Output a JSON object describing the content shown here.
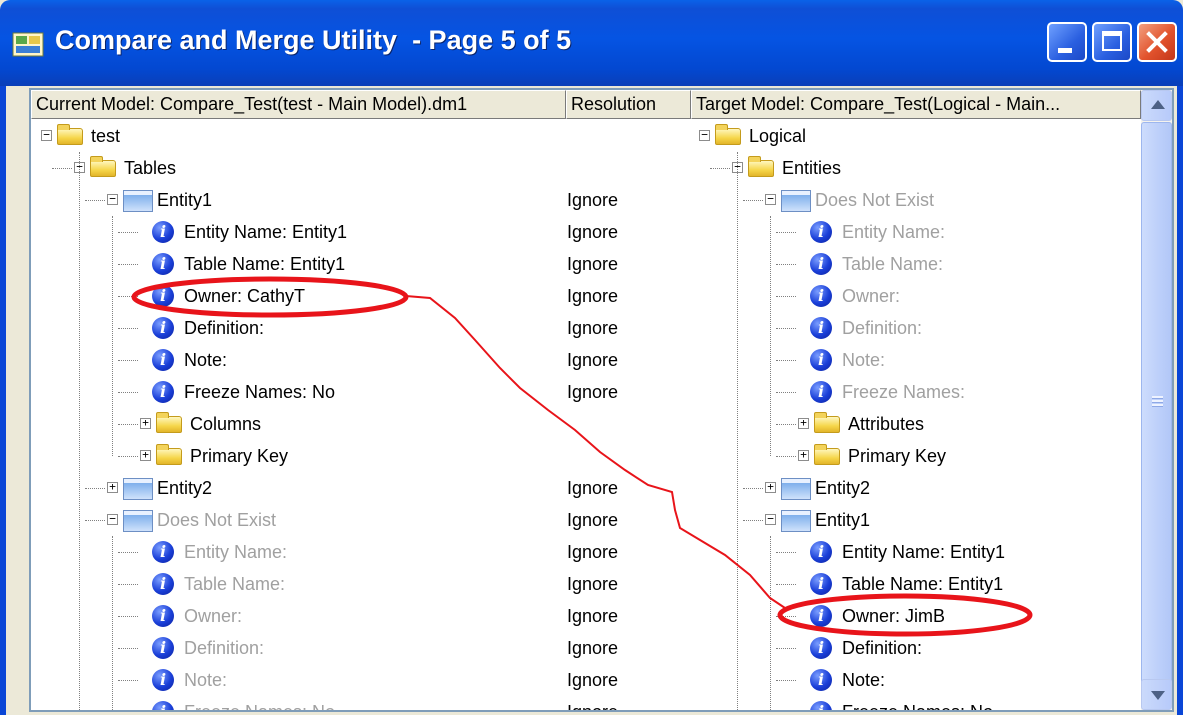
{
  "window": {
    "title": "Compare and Merge Utility  - Page 5 of 5",
    "buttons": {
      "minimize": "minimize",
      "maximize": "maximize",
      "close": "close"
    }
  },
  "columns": {
    "current": "Current Model: Compare_Test(test - Main Model).dm1",
    "resolution": "Resolution",
    "target": "Target Model: Compare_Test(Logical - Main..."
  },
  "left_tree": [
    {
      "text": "test",
      "icon": "folder",
      "expander": "minus",
      "dim": false,
      "res": ""
    },
    {
      "text": "Tables",
      "icon": "folder",
      "expander": "minus",
      "dim": false,
      "res": ""
    },
    {
      "text": "Entity1",
      "icon": "table",
      "expander": "minus",
      "dim": false,
      "res": "Ignore"
    },
    {
      "text": "Entity Name: Entity1",
      "icon": "info",
      "expander": "",
      "dim": false,
      "res": "Ignore"
    },
    {
      "text": "Table Name: Entity1",
      "icon": "info",
      "expander": "",
      "dim": false,
      "res": "Ignore"
    },
    {
      "text": "Owner: CathyT",
      "icon": "info",
      "expander": "",
      "dim": false,
      "res": "Ignore"
    },
    {
      "text": "Definition:",
      "icon": "info",
      "expander": "",
      "dim": false,
      "res": "Ignore"
    },
    {
      "text": "Note:",
      "icon": "info",
      "expander": "",
      "dim": false,
      "res": "Ignore"
    },
    {
      "text": "Freeze Names: No",
      "icon": "info",
      "expander": "",
      "dim": false,
      "res": "Ignore"
    },
    {
      "text": "Columns",
      "icon": "folder",
      "expander": "plus",
      "dim": false,
      "res": ""
    },
    {
      "text": "Primary Key",
      "icon": "folder",
      "expander": "plus",
      "dim": false,
      "res": ""
    },
    {
      "text": "Entity2",
      "icon": "table",
      "expander": "plus",
      "dim": false,
      "res": "Ignore"
    },
    {
      "text": "Does Not Exist",
      "icon": "table",
      "expander": "minus",
      "dim": true,
      "res": "Ignore"
    },
    {
      "text": "Entity Name:",
      "icon": "info",
      "expander": "",
      "dim": true,
      "res": "Ignore"
    },
    {
      "text": "Table Name:",
      "icon": "info",
      "expander": "",
      "dim": true,
      "res": "Ignore"
    },
    {
      "text": "Owner:",
      "icon": "info",
      "expander": "",
      "dim": true,
      "res": "Ignore"
    },
    {
      "text": "Definition:",
      "icon": "info",
      "expander": "",
      "dim": true,
      "res": "Ignore"
    },
    {
      "text": "Note:",
      "icon": "info",
      "expander": "",
      "dim": true,
      "res": "Ignore"
    },
    {
      "text": "Freeze Names: No",
      "icon": "info",
      "expander": "",
      "dim": true,
      "res": "Ignore"
    }
  ],
  "right_tree": [
    {
      "text": "Logical",
      "icon": "folder",
      "expander": "minus",
      "dim": false
    },
    {
      "text": "Entities",
      "icon": "folder",
      "expander": "minus",
      "dim": false
    },
    {
      "text": "Does Not Exist",
      "icon": "table",
      "expander": "minus",
      "dim": true
    },
    {
      "text": "Entity Name:",
      "icon": "info",
      "expander": "",
      "dim": true
    },
    {
      "text": "Table Name:",
      "icon": "info",
      "expander": "",
      "dim": true
    },
    {
      "text": "Owner:",
      "icon": "info",
      "expander": "",
      "dim": true
    },
    {
      "text": "Definition:",
      "icon": "info",
      "expander": "",
      "dim": true
    },
    {
      "text": "Note:",
      "icon": "info",
      "expander": "",
      "dim": true
    },
    {
      "text": "Freeze Names:",
      "icon": "info",
      "expander": "",
      "dim": true
    },
    {
      "text": "Attributes",
      "icon": "folder",
      "expander": "plus",
      "dim": false
    },
    {
      "text": "Primary Key",
      "icon": "folder",
      "expander": "plus",
      "dim": false
    },
    {
      "text": "Entity2",
      "icon": "table",
      "expander": "plus",
      "dim": false
    },
    {
      "text": "Entity1",
      "icon": "table",
      "expander": "minus",
      "dim": false
    },
    {
      "text": "Entity Name: Entity1",
      "icon": "info",
      "expander": "",
      "dim": false
    },
    {
      "text": "Table Name: Entity1",
      "icon": "info",
      "expander": "",
      "dim": false
    },
    {
      "text": "Owner: JimB",
      "icon": "info",
      "expander": "",
      "dim": false
    },
    {
      "text": "Definition:",
      "icon": "info",
      "expander": "",
      "dim": false
    },
    {
      "text": "Note:",
      "icon": "info",
      "expander": "",
      "dim": false
    },
    {
      "text": "Freeze Names: No",
      "icon": "info",
      "expander": "",
      "dim": false
    }
  ],
  "annotation": {
    "color": "#e8141a"
  }
}
